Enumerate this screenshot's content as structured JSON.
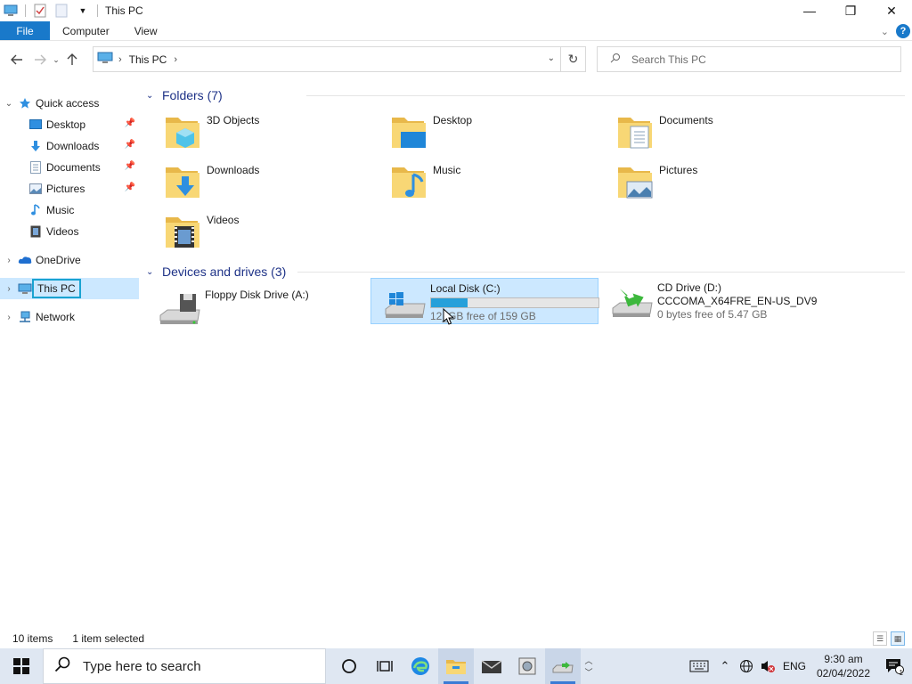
{
  "window": {
    "title": "This PC",
    "controls": {
      "minimize": "—",
      "maximize": "❐",
      "close": "✕"
    }
  },
  "ribbon": {
    "tabs": [
      "File",
      "Computer",
      "View"
    ],
    "help": "?"
  },
  "address": {
    "crumbs": [
      "This PC"
    ],
    "search_placeholder": "Search This PC"
  },
  "nav": {
    "quick_access": "Quick access",
    "quick_items": [
      {
        "label": "Desktop",
        "icon": "desktop-icon",
        "pinned": true
      },
      {
        "label": "Downloads",
        "icon": "downloads-icon",
        "pinned": true
      },
      {
        "label": "Documents",
        "icon": "documents-icon",
        "pinned": true
      },
      {
        "label": "Pictures",
        "icon": "pictures-icon",
        "pinned": true
      },
      {
        "label": "Music",
        "icon": "music-icon",
        "pinned": false
      },
      {
        "label": "Videos",
        "icon": "videos-icon",
        "pinned": false
      }
    ],
    "onedrive": "OneDrive",
    "this_pc": "This PC",
    "network": "Network"
  },
  "content": {
    "folders_header": "Folders (7)",
    "folders": [
      {
        "name": "3D Objects",
        "icon": "3d-objects-icon"
      },
      {
        "name": "Desktop",
        "icon": "desktop-folder-icon"
      },
      {
        "name": "Documents",
        "icon": "documents-folder-icon"
      },
      {
        "name": "Downloads",
        "icon": "downloads-folder-icon"
      },
      {
        "name": "Music",
        "icon": "music-folder-icon"
      },
      {
        "name": "Pictures",
        "icon": "pictures-folder-icon"
      },
      {
        "name": "Videos",
        "icon": "videos-folder-icon"
      }
    ],
    "drives_header": "Devices and drives (3)",
    "drives": [
      {
        "name": "Floppy Disk Drive (A:)",
        "line2": "",
        "free": "",
        "used_fraction": null,
        "icon": "floppy-drive-icon",
        "selected": false
      },
      {
        "name": "Local Disk (C:)",
        "line2": "",
        "free": "12_GB free of 159 GB",
        "used_fraction": 0.22,
        "icon": "local-disk-icon",
        "selected": true
      },
      {
        "name": "CD Drive (D:)",
        "line2": "CCCOMA_X64FRE_EN-US_DV9",
        "free": "0 bytes free of 5.47 GB",
        "used_fraction": null,
        "icon": "cd-drive-icon",
        "selected": false
      }
    ]
  },
  "status": {
    "items_count": "10 items",
    "selected": "1 item selected"
  },
  "taskbar": {
    "search_placeholder": "Type here to search",
    "tray_lang": "ENG",
    "time": "9:30 am",
    "date": "02/04/2022",
    "notification_count": "1"
  },
  "colors": {
    "accent": "#1979ca",
    "selection": "#cce8ff",
    "group_header": "#1e3287",
    "progress": "#26a0da",
    "folder_yellow": "#f8d775"
  }
}
